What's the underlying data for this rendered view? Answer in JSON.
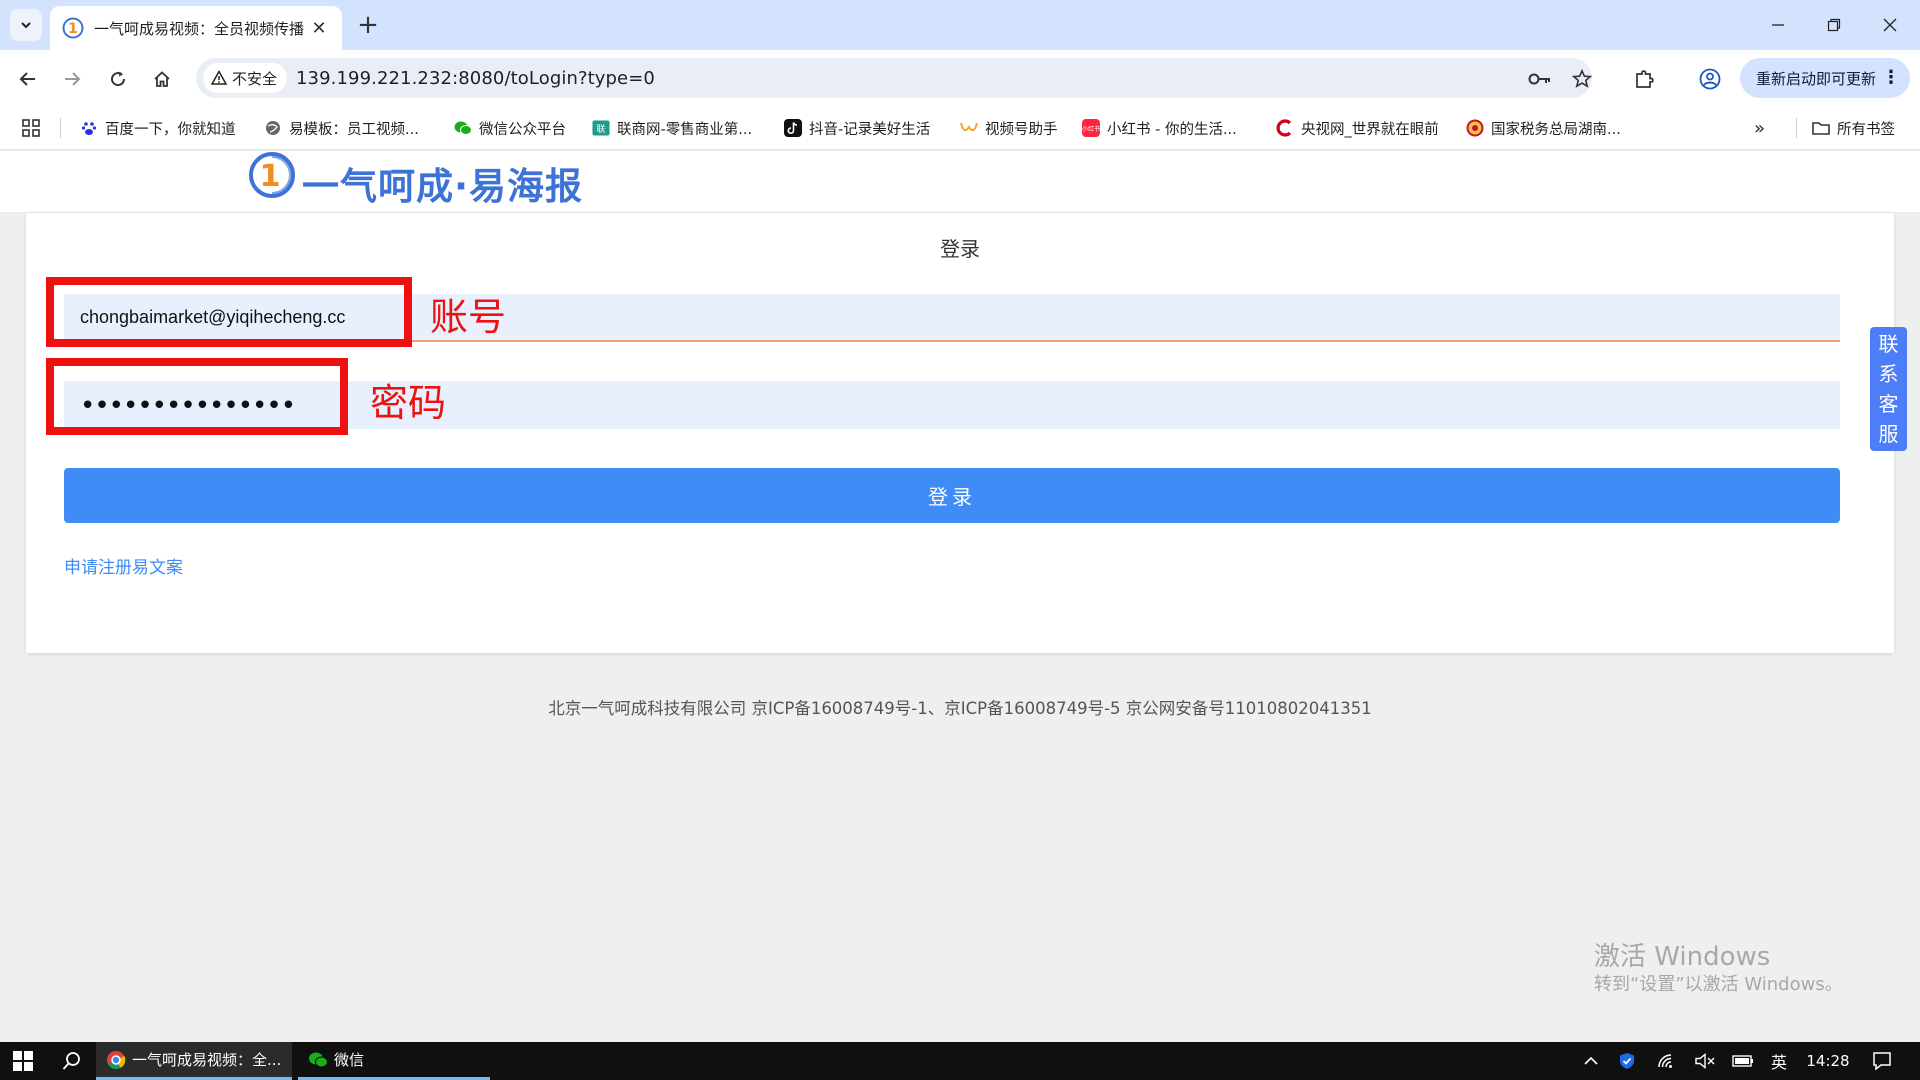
{
  "browser": {
    "tab_title": "一气呵成易视频：全员视频传播",
    "tab_close": "✕",
    "new_tab": "+",
    "security_label": "不安全",
    "url": "139.199.221.232:8080/toLogin?type=0",
    "update_label": "重新启动即可更新",
    "update_more": "⋮",
    "bookmarks": [
      {
        "label": "百度一下，你就知道",
        "icon": "baidu-icon",
        "color": "#2932e1"
      },
      {
        "label": "易模板：员工视频...",
        "icon": "globe-icon",
        "color": "#555555"
      },
      {
        "label": "微信公众平台",
        "icon": "wechat-icon",
        "color": "#1aad19"
      },
      {
        "label": "联商网-零售商业第...",
        "icon": "lianshang-icon",
        "color": "#1a9e8f"
      },
      {
        "label": "抖音-记录美好生活",
        "icon": "douyin-icon",
        "color": "#111111"
      },
      {
        "label": "视频号助手",
        "icon": "channels-icon",
        "color": "#f5a623"
      },
      {
        "label": "小红书 - 你的生活...",
        "icon": "xiaohongshu-icon",
        "color": "#ff2442"
      },
      {
        "label": "央视网_世界就在眼前",
        "icon": "cctv-icon",
        "color": "#d0021b"
      },
      {
        "label": "国家税务总局湖南...",
        "icon": "tax-emblem-icon",
        "color": "#c8102e"
      }
    ],
    "bookmarks_more": "»",
    "all_bookmarks": "所有书签"
  },
  "site": {
    "logo_text": "一气呵成·易海报",
    "brand_color": "#3d73d6",
    "accent_color": "#f28c1e"
  },
  "login": {
    "title": "登录",
    "account_value": "chongbaimarket@yiqihecheng.cc",
    "password_mask": "•••••••••••••••",
    "button_label": "登录",
    "register_link": "申请注册易文案",
    "button_color": "#3f8cf6"
  },
  "annotations": {
    "account_label": "账号",
    "password_label": "密码",
    "color": "#ee1111"
  },
  "side_contact": [
    "联",
    "系",
    "客",
    "服"
  ],
  "footer": "北京一气呵成科技有限公司 京ICP备16008749号-1、京ICP备16008749号-5 京公网安备号11010802041351",
  "watermark": {
    "line1": "激活 Windows",
    "line2": "转到“设置”以激活 Windows。"
  },
  "taskbar": {
    "apps": [
      {
        "label": "一气呵成易视频：全...",
        "icon": "chrome-icon"
      },
      {
        "label": "微信",
        "icon": "wechat-icon"
      }
    ],
    "ime": "英",
    "time": "14:28"
  }
}
